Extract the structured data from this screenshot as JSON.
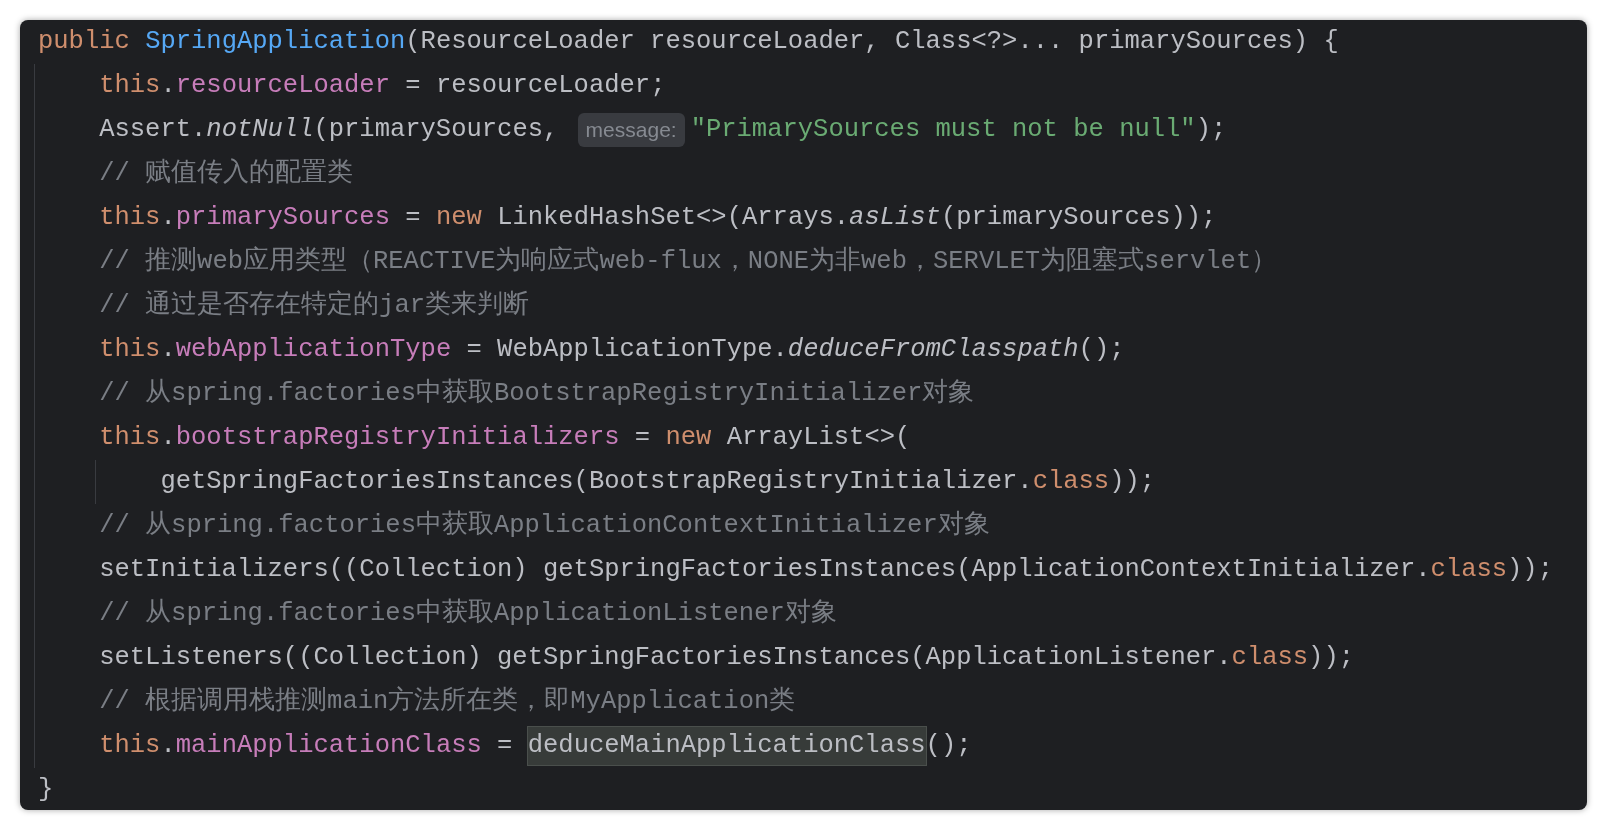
{
  "code": {
    "lines": [
      {
        "tokens": [
          {
            "kind": "keyword",
            "text": "public "
          },
          {
            "kind": "method",
            "text": "SpringApplication"
          },
          {
            "kind": "plain",
            "text": "(ResourceLoader resourceLoader, Class<?>... primarySources) {"
          }
        ],
        "children": [
          {
            "tokens": [
              {
                "kind": "keyword",
                "text": "this"
              },
              {
                "kind": "plain",
                "text": "."
              },
              {
                "kind": "field",
                "text": "resourceLoader"
              },
              {
                "kind": "plain",
                "text": " = resourceLoader;"
              }
            ]
          },
          {
            "tokens": [
              {
                "kind": "plain",
                "text": "Assert."
              },
              {
                "kind": "static",
                "text": "notNull"
              },
              {
                "kind": "plain",
                "text": "(primarySources, "
              },
              {
                "kind": "hint",
                "text": "message:"
              },
              {
                "kind": "string",
                "text": "\"PrimarySources must not be null\""
              },
              {
                "kind": "plain",
                "text": ");"
              }
            ]
          },
          {
            "tokens": [
              {
                "kind": "comment",
                "text": "// 赋值传入的配置类"
              }
            ]
          },
          {
            "tokens": [
              {
                "kind": "keyword",
                "text": "this"
              },
              {
                "kind": "plain",
                "text": "."
              },
              {
                "kind": "field",
                "text": "primarySources"
              },
              {
                "kind": "plain",
                "text": " = "
              },
              {
                "kind": "keyword",
                "text": "new"
              },
              {
                "kind": "plain",
                "text": " LinkedHashSet<>(Arrays."
              },
              {
                "kind": "static",
                "text": "asList"
              },
              {
                "kind": "plain",
                "text": "(primarySources));"
              }
            ]
          },
          {
            "tokens": [
              {
                "kind": "comment",
                "text": "// 推测web应用类型（REACTIVE为响应式web-flux，NONE为非web，SERVLET为阻塞式servlet）"
              }
            ]
          },
          {
            "tokens": [
              {
                "kind": "comment",
                "text": "// 通过是否存在特定的jar类来判断"
              }
            ]
          },
          {
            "tokens": [
              {
                "kind": "keyword",
                "text": "this"
              },
              {
                "kind": "plain",
                "text": "."
              },
              {
                "kind": "field",
                "text": "webApplicationType"
              },
              {
                "kind": "plain",
                "text": " = WebApplicationType."
              },
              {
                "kind": "static",
                "text": "deduceFromClasspath"
              },
              {
                "kind": "plain",
                "text": "();"
              }
            ]
          },
          {
            "tokens": [
              {
                "kind": "comment",
                "text": "// 从spring.factories中获取BootstrapRegistryInitializer对象"
              }
            ]
          },
          {
            "tokens": [
              {
                "kind": "keyword",
                "text": "this"
              },
              {
                "kind": "plain",
                "text": "."
              },
              {
                "kind": "field",
                "text": "bootstrapRegistryInitializers"
              },
              {
                "kind": "plain",
                "text": " = "
              },
              {
                "kind": "keyword",
                "text": "new"
              },
              {
                "kind": "plain",
                "text": " ArrayList<>("
              }
            ],
            "children": [
              {
                "tokens": [
                  {
                    "kind": "plain",
                    "text": "getSpringFactoriesInstances(BootstrapRegistryInitializer."
                  },
                  {
                    "kind": "keyword",
                    "text": "class"
                  },
                  {
                    "kind": "plain",
                    "text": "));"
                  }
                ]
              }
            ]
          },
          {
            "tokens": [
              {
                "kind": "comment",
                "text": "// 从spring.factories中获取ApplicationContextInitializer对象"
              }
            ]
          },
          {
            "tokens": [
              {
                "kind": "plain",
                "text": "setInitializers((Collection) getSpringFactoriesInstances(ApplicationContextInitializer."
              },
              {
                "kind": "keyword",
                "text": "class"
              },
              {
                "kind": "plain",
                "text": "));"
              }
            ]
          },
          {
            "tokens": [
              {
                "kind": "comment",
                "text": "// 从spring.factories中获取ApplicationListener对象"
              }
            ]
          },
          {
            "tokens": [
              {
                "kind": "plain",
                "text": "setListeners((Collection) getSpringFactoriesInstances(ApplicationListener."
              },
              {
                "kind": "keyword",
                "text": "class"
              },
              {
                "kind": "plain",
                "text": "));"
              }
            ]
          },
          {
            "tokens": [
              {
                "kind": "comment",
                "text": "// 根据调用栈推测main方法所在类，即MyApplication类"
              }
            ]
          },
          {
            "tokens": [
              {
                "kind": "keyword",
                "text": "this"
              },
              {
                "kind": "plain",
                "text": "."
              },
              {
                "kind": "field",
                "text": "mainApplicationClass"
              },
              {
                "kind": "plain",
                "text": " = "
              },
              {
                "kind": "highlight",
                "text": "deduceMainApplicationClass"
              },
              {
                "kind": "plain",
                "text": "();"
              }
            ]
          }
        ]
      },
      {
        "tokens": [
          {
            "kind": "plain",
            "text": "}"
          }
        ]
      }
    ]
  }
}
